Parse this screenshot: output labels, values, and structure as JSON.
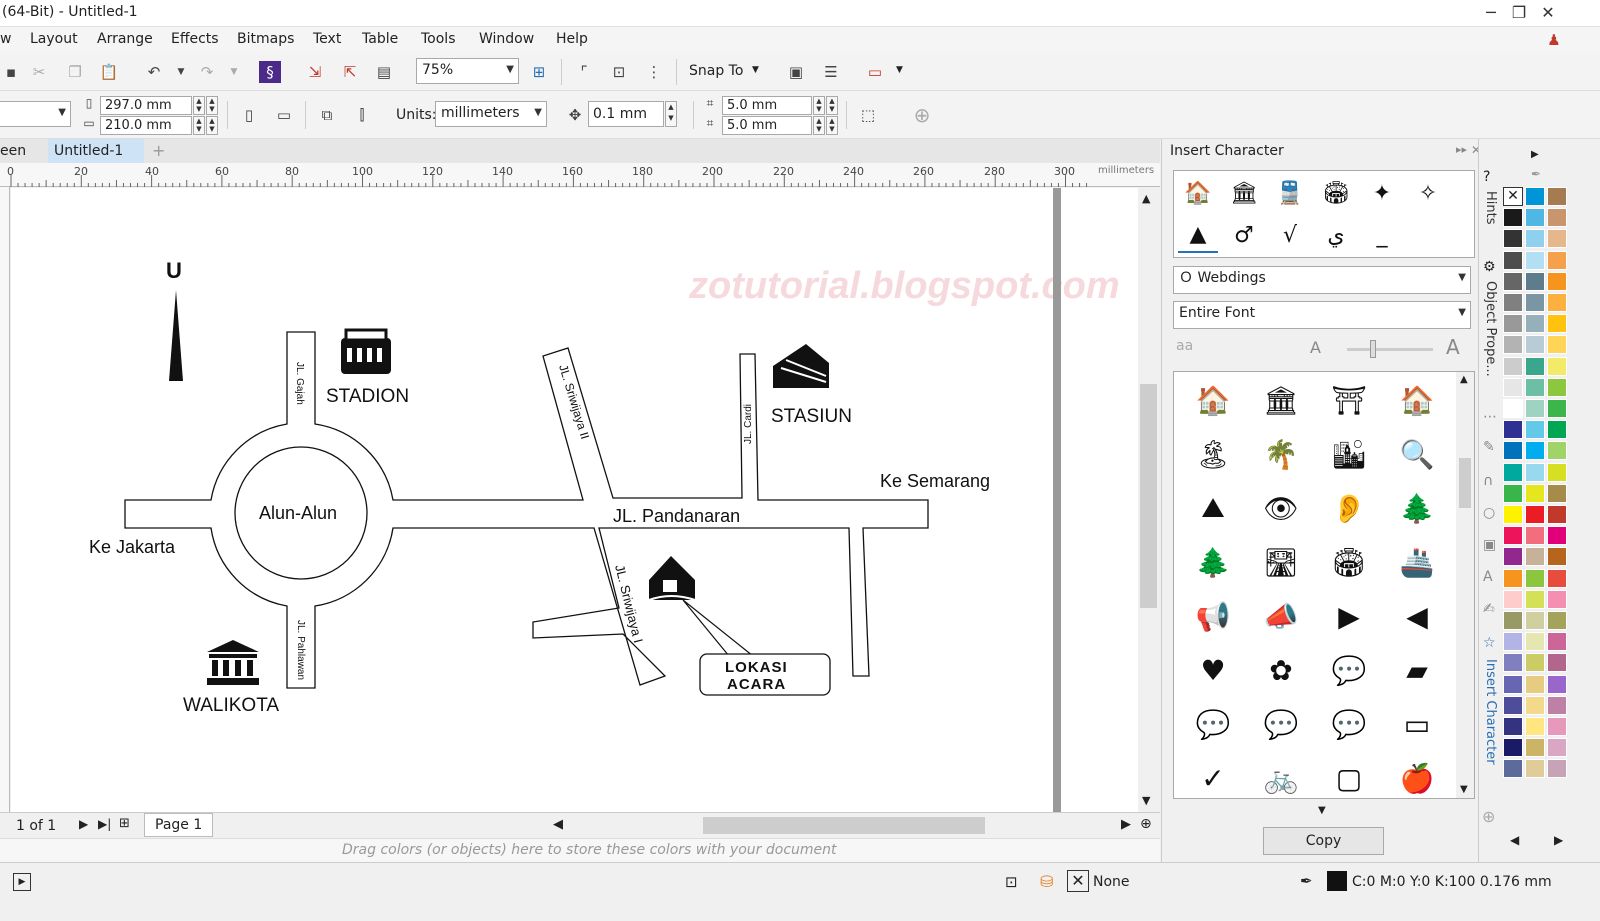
{
  "window": {
    "title": "(64-Bit) - Untitled-1",
    "minimize": "─",
    "restore": "❐",
    "close": "✕"
  },
  "menu": {
    "items": [
      "w",
      "Layout",
      "Arrange",
      "Effects",
      "Bitmaps",
      "Text",
      "Table",
      "Tools",
      "Window",
      "Help"
    ]
  },
  "toolbar": {
    "zoom": "75%",
    "snap_to": "Snap To"
  },
  "propertybar": {
    "width": "297.0 mm",
    "height": "210.0 mm",
    "units_label": "Units:",
    "units_value": "millimeters",
    "nudge": "0.1 mm",
    "dup_x": "5.0 mm",
    "dup_y": "5.0 mm"
  },
  "tabs": {
    "welcome": "een",
    "document": "Untitled-1",
    "add": "+"
  },
  "ruler": {
    "ticks": [
      "0",
      "20",
      "40",
      "60",
      "80",
      "100",
      "120",
      "140",
      "160",
      "180",
      "200",
      "220",
      "240",
      "260",
      "280",
      "300"
    ],
    "unit": "millimeters"
  },
  "map": {
    "north": "U",
    "stadion": "STADION",
    "stasiun": "STASIUN",
    "walikota": "WALIKOTA",
    "alun_alun": "Alun-Alun",
    "ke_jakarta": "Ke Jakarta",
    "ke_semarang": "Ke Semarang",
    "jl_pandanaran": "JL. Pandanaran",
    "jl_gajah": "JL. Gajah",
    "jl_sriwijaya_2": "JL. Sriwijaya II",
    "jl_cardi": "JL. Cardi",
    "jl_sriwijaya_1": "JL. Sriwijaya I",
    "jl_pahlawan": "JL. Pahlawan",
    "lokasi": "LOKASI",
    "acara": "ACARA",
    "watermark": "zotutorial.blogspot.com"
  },
  "pagebar": {
    "counter": "1 of 1",
    "page_tab": "Page 1"
  },
  "colorstrip": {
    "hint": "Drag colors (or objects) here to store these colors with your document"
  },
  "statusbar": {
    "fill": "None",
    "outline": "C:0 M:0 Y:0 K:100  0.176 mm"
  },
  "docker": {
    "title": "Insert Character",
    "font": "Webdings",
    "subset": "Entire Font",
    "copy": "Copy",
    "glyphs": [
      "🏠",
      "🏛",
      "⛩",
      "🏠",
      "🏝",
      "🌴",
      "🏙",
      "🔍",
      "⛰",
      "👁",
      "👂",
      "🌲",
      "🌲",
      "🛣",
      "🏟",
      "🚢",
      "📢",
      "📣",
      "▶",
      "◀",
      "♥",
      "✿",
      "💬",
      "▰",
      "💬",
      "💬",
      "💬",
      "▭",
      "✓",
      "🚲",
      "▢",
      "🍎"
    ],
    "recent": [
      "🏠",
      "🏛",
      "🚆",
      "🏟",
      "✦",
      "✧",
      "▲",
      "♂",
      "√",
      "ي",
      "_"
    ]
  },
  "side_tabs": [
    "Hints",
    "Object Prope...",
    "Insert Character"
  ],
  "palette": {
    "colors": [
      [
        "#000000",
        "#0095d6",
        "#a57c52"
      ],
      [
        "#1a1a1a",
        "#4fb7e4",
        "#c8956c"
      ],
      [
        "#333333",
        "#8fd0ee",
        "#e5b78a"
      ],
      [
        "#4d4d4d",
        "#b3dff4",
        "#f4a04c"
      ],
      [
        "#666666",
        "#5e7c8c",
        "#f7941d"
      ],
      [
        "#808080",
        "#7a96a4",
        "#fbb040"
      ],
      [
        "#999999",
        "#96b0bb",
        "#ffc20e"
      ],
      [
        "#b3b3b3",
        "#b7ccd4",
        "#ffd457"
      ],
      [
        "#cccccc",
        "#3aa68c",
        "#f3ea69"
      ],
      [
        "#e6e6e6",
        "#6cbfa4",
        "#8dc63f"
      ],
      [
        "#ffffff",
        "#9ed3c1",
        "#3cb54a"
      ],
      [
        "#2e3192",
        "#62c9e8",
        "#00a651"
      ],
      [
        "#0072bc",
        "#00aeef",
        "#a0d468"
      ],
      [
        "#00a99d",
        "#98d9ef",
        "#d7df23"
      ],
      [
        "#39b54a",
        "#e6e620",
        "#a68c4a"
      ],
      [
        "#fff200",
        "#ec1c24",
        "#c0392b"
      ],
      [
        "#ed145b",
        "#f26d7d",
        "#e2007a"
      ],
      [
        "#92278f",
        "#c7b299",
        "#b5651d"
      ],
      [
        "#f7941d",
        "#8cc63e",
        "#e74c3c"
      ],
      [
        "#ffcccc",
        "#d4e157",
        "#f48fb1"
      ],
      [
        "#999966",
        "#cfcf9f",
        "#a3a35b"
      ],
      [
        "#b3b3e6",
        "#e6e6b3",
        "#cc6699"
      ],
      [
        "#8080c0",
        "#cccc66",
        "#b3668c"
      ],
      [
        "#6666b3",
        "#e6cc80",
        "#9966cc"
      ],
      [
        "#4d4d99",
        "#f2d98c",
        "#bf80a6"
      ],
      [
        "#333380",
        "#ffe680",
        "#e699bb"
      ],
      [
        "#1a1a66",
        "#ccb366",
        "#d9a6c4"
      ],
      [
        "#5c6b9c",
        "#e0cc99",
        "#c7a3b8"
      ]
    ]
  }
}
